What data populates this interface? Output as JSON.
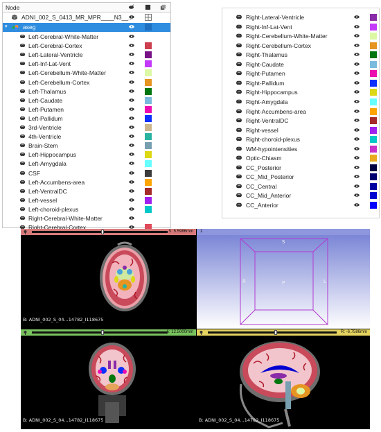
{
  "tree": {
    "header": {
      "title": "Node"
    },
    "volume_node": {
      "label": "ADNI_002_S_0413_MR_MPR____N3__..."
    },
    "segmentation_node": {
      "label": "aseg"
    },
    "segments": [
      {
        "label": "Left-Cerebral-White-Matter",
        "color": ""
      },
      {
        "label": "Left-Cerebral-Cortex",
        "color": "#cd3e4e"
      },
      {
        "label": "Left-Lateral-Ventricle",
        "color": "#781286"
      },
      {
        "label": "Left-Inf-Lat-Vent",
        "color": "#c43afa"
      },
      {
        "label": "Left-Cerebellum-White-Matter",
        "color": "#dcf8a4"
      },
      {
        "label": "Left-Cerebellum-Cortex",
        "color": "#e69422"
      },
      {
        "label": "Left-Thalamus",
        "color": "#00760e"
      },
      {
        "label": "Left-Caudate",
        "color": "#7abadc"
      },
      {
        "label": "Left-Putamen",
        "color": "#ec0db0"
      },
      {
        "label": "Left-Pallidum",
        "color": "#0c30ff"
      },
      {
        "label": "3rd-Ventricle",
        "color": "#cc b68e"
      },
      {
        "label": "4th-Ventricle",
        "color": "#2ab3a0"
      },
      {
        "label": "Brain-Stem",
        "color": "#779fb0"
      },
      {
        "label": "Left-Hippocampus",
        "color": "#dcd814"
      },
      {
        "label": "Left-Amygdala",
        "color": "#67ffff"
      },
      {
        "label": "CSF",
        "color": "#3c3c3c"
      },
      {
        "label": "Left-Accumbens-area",
        "color": "#ffa500"
      },
      {
        "label": "Left-VentralDC",
        "color": "#a52a2a"
      },
      {
        "label": "Left-vessel",
        "color": "#a020f0"
      },
      {
        "label": "Left-choroid-plexus",
        "color": "#00c8c8"
      },
      {
        "label": "Right-Cerebral-White-Matter",
        "color": ""
      },
      {
        "label": "Right-Cerebral-Cortex",
        "color": "#e04a5a"
      }
    ]
  },
  "right_list": [
    {
      "label": "Right-Lateral-Ventricle",
      "color": "#8a2ba8"
    },
    {
      "label": "Right-Inf-Lat-Vent",
      "color": "#c43afa"
    },
    {
      "label": "Right-Cerebellum-White-Matter",
      "color": "#dcf8a4"
    },
    {
      "label": "Right-Cerebellum-Cortex",
      "color": "#e69422"
    },
    {
      "label": "Right-Thalamus",
      "color": "#00760e"
    },
    {
      "label": "Right-Caudate",
      "color": "#7abadc"
    },
    {
      "label": "Right-Putamen",
      "color": "#ec0db0"
    },
    {
      "label": "Right-Pallidum",
      "color": "#0c30ff"
    },
    {
      "label": "Right-Hippocampus",
      "color": "#dcd814"
    },
    {
      "label": "Right-Amygdala",
      "color": "#67ffff"
    },
    {
      "label": "Right-Accumbens-area",
      "color": "#ffa500"
    },
    {
      "label": "Right-VentralDC",
      "color": "#a52a2a"
    },
    {
      "label": "Right-vessel",
      "color": "#a020f0"
    },
    {
      "label": "Right-choroid-plexus",
      "color": "#00c8c8"
    },
    {
      "label": "WM-hypointensities",
      "color": "#c832c8"
    },
    {
      "label": "Optic-Chiasm",
      "color": "#eaa91e"
    },
    {
      "label": "CC_Posterior",
      "color": "#000040"
    },
    {
      "label": "CC_Mid_Posterior",
      "color": "#000070"
    },
    {
      "label": "CC_Central",
      "color": "#0000a0"
    },
    {
      "label": "CC_Mid_Anterior",
      "color": "#0000d0"
    },
    {
      "label": "CC_Anterior",
      "color": "#0000ff"
    }
  ],
  "viewer": {
    "red": {
      "letter": "S",
      "readout": "S: 5.5986mm",
      "caption": "B: ADNI_002_S_04...14782_I118675",
      "bar_color": "#d97a7a",
      "slider_fraction": 0.5
    },
    "threed": {
      "label": "1",
      "bar_color": "#7b86d6",
      "dir_s": "S",
      "dir_r": "R",
      "dir_l": "L",
      "dir_p": "P",
      "dir_i": "I"
    },
    "green": {
      "letter": "G",
      "readout": "A: 12.5000mm",
      "caption": "B: ADNI_002_S_04...14782_I118675",
      "bar_color": "#79c35e",
      "slider_fraction": 0.55
    },
    "yellow": {
      "letter": "Y",
      "readout": "R: -6.7586mm",
      "caption": "B: ADNI_002_S_04...14782_I118675",
      "bar_color": "#e4d35f",
      "slider_fraction": 0.45
    }
  }
}
